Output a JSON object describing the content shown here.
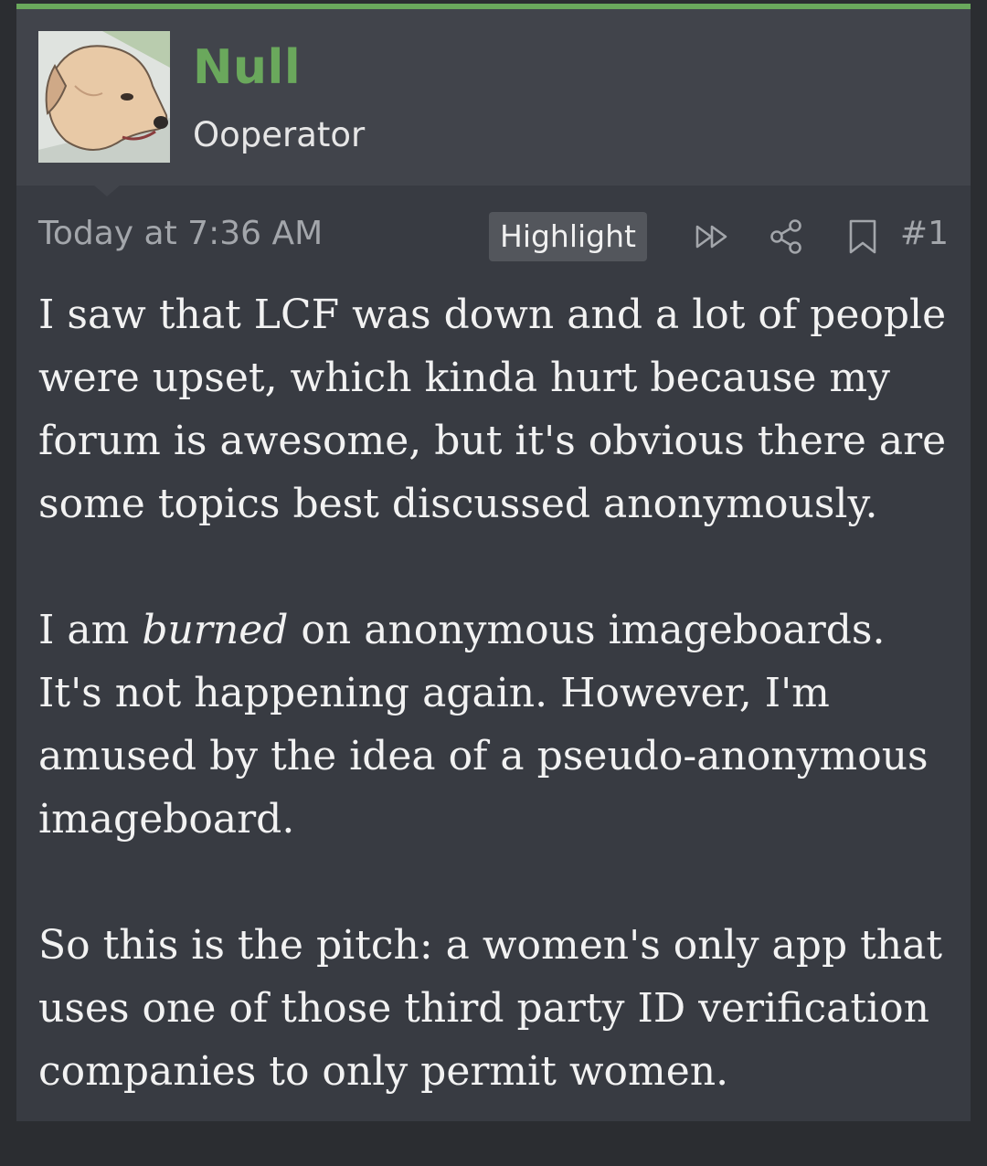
{
  "user": {
    "name": "Null",
    "title": "Ooperator",
    "avatar_icon": "dog-avatar-icon"
  },
  "meta": {
    "timestamp": "Today at 7:36 AM",
    "highlight_label": "Highlight",
    "post_number": "#1",
    "icons": [
      "fast-forward-icon",
      "share-icon",
      "bookmark-icon"
    ]
  },
  "post": {
    "p1": [
      "I saw that LCF was down and a lot of people",
      "were upset, which kinda hurt because my",
      "forum is awesome, but it's obvious there are",
      "some topics best discussed anonymously."
    ],
    "p2": {
      "l1_before": "I am ",
      "l1_em": "burned",
      "l1_after": " on anonymous imageboards.",
      "l2": "It's not happening again. However, I'm",
      "l3": "amused by the idea of a pseudo-anonymous",
      "l4": "imageboard."
    },
    "p3": [
      "So this is the pitch: a women's only app that",
      "uses one of those third party ID verification",
      "companies to only permit women."
    ]
  },
  "colors": {
    "accent": "#6aa85c",
    "post_bg": "#383b42",
    "header_bg": "#41444b",
    "text": "#f2f2f2",
    "muted": "#a3a6ab"
  }
}
